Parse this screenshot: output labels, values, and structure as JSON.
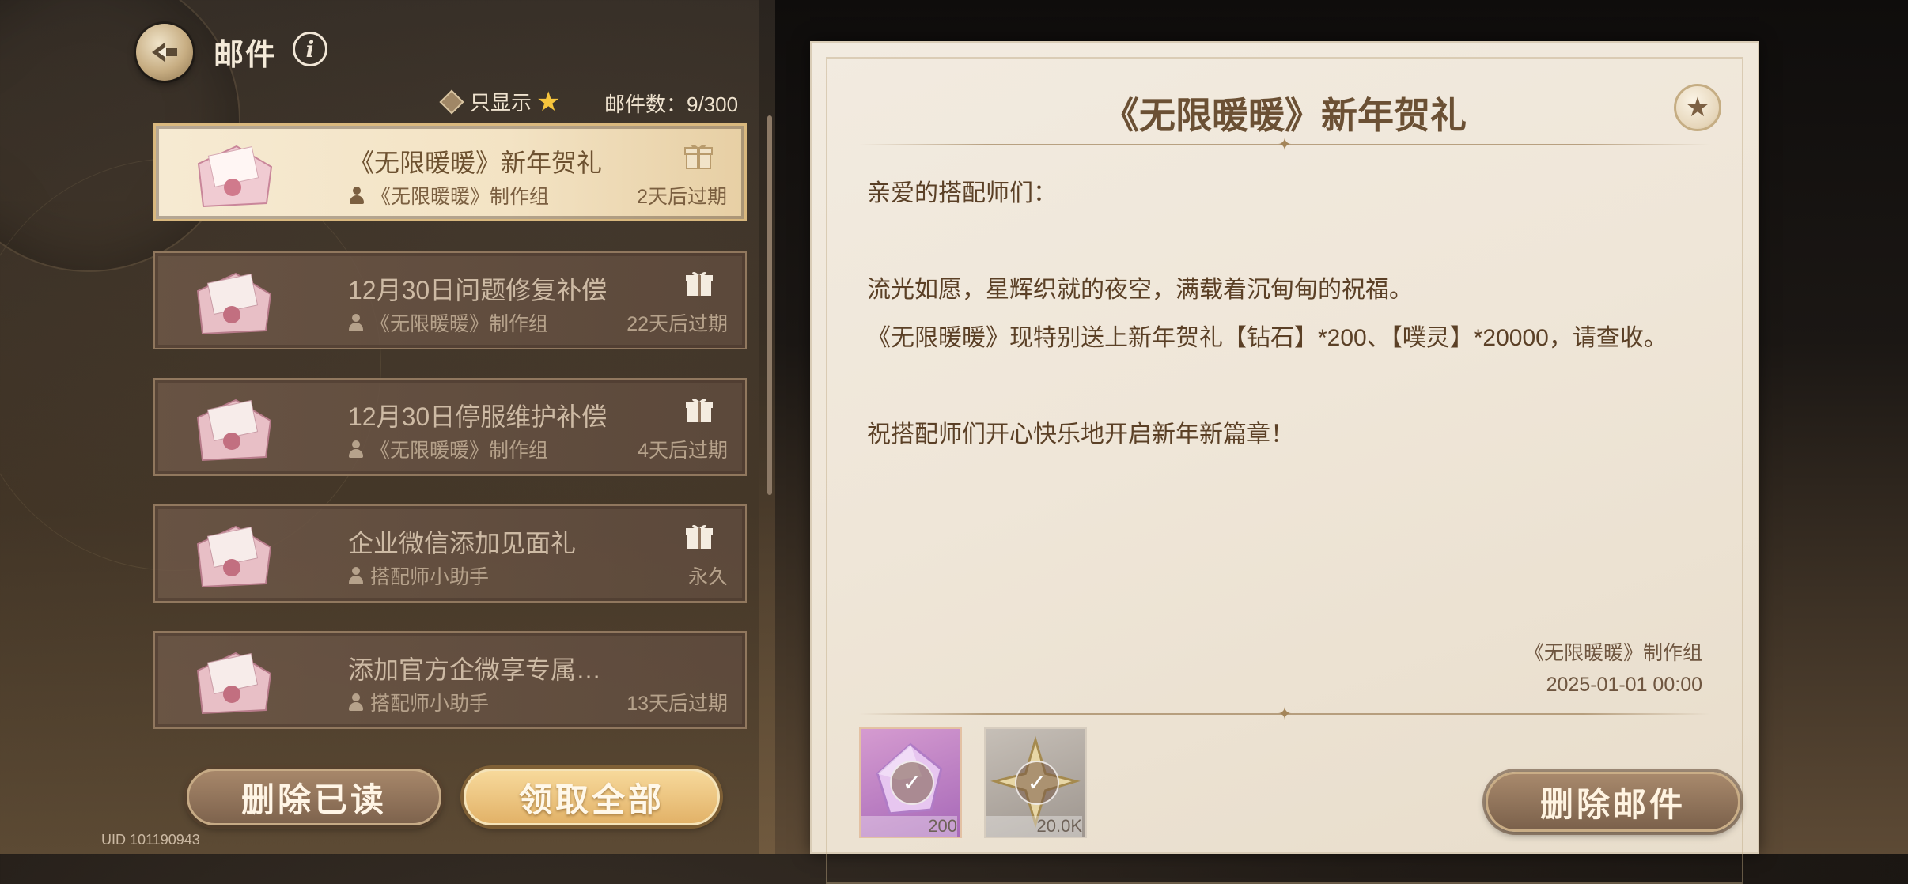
{
  "header": {
    "title": "邮件",
    "info_symbol": "i"
  },
  "filter": {
    "label": "只显示",
    "star_symbol": "★",
    "mail_count": "邮件数：9/300"
  },
  "mails": [
    {
      "title": "《无限暖暖》新年贺礼",
      "sender": "《无限暖暖》制作组",
      "expiry": "2天后过期",
      "active": true,
      "has_gift": true
    },
    {
      "title": "12月30日问题修复补偿",
      "sender": "《无限暖暖》制作组",
      "expiry": "22天后过期",
      "active": false,
      "has_gift": true
    },
    {
      "title": "12月30日停服维护补偿",
      "sender": "《无限暖暖》制作组",
      "expiry": "4天后过期",
      "active": false,
      "has_gift": true
    },
    {
      "title": "企业微信添加见面礼",
      "sender": "搭配师小助手",
      "expiry": "永久",
      "active": false,
      "has_gift": true
    },
    {
      "title": "添加官方企微享专属…",
      "sender": "搭配师小助手",
      "expiry": "13天后过期",
      "active": false,
      "has_gift": false
    }
  ],
  "buttons": {
    "delete_read": "删除已读",
    "claim_all": "领取全部",
    "delete_mail": "删除邮件"
  },
  "uid": "UID 101190943",
  "letter": {
    "title": "《无限暖暖》新年贺礼",
    "fav_symbol": "★",
    "greeting": "亲爱的搭配师们：",
    "para1": "流光如愿，星辉织就的夜空，满载着沉甸甸的祝福。",
    "para2": "《无限暖暖》现特别送上新年贺礼【钻石】*200、【噗灵】*20000，请查收。",
    "para3": "祝搭配师们开心快乐地开启新年新篇章！",
    "signature": "《无限暖暖》制作组",
    "date": "2025-01-01 00:00"
  },
  "rewards": [
    {
      "name": "diamond-icon",
      "qty": "200",
      "check": "✓"
    },
    {
      "name": "puling-icon",
      "qty": "20.0K",
      "check": "✓"
    }
  ],
  "colors": {
    "accent_gold": "#e2b268",
    "letter_text": "#5b4026",
    "star": "#f6c53d"
  }
}
